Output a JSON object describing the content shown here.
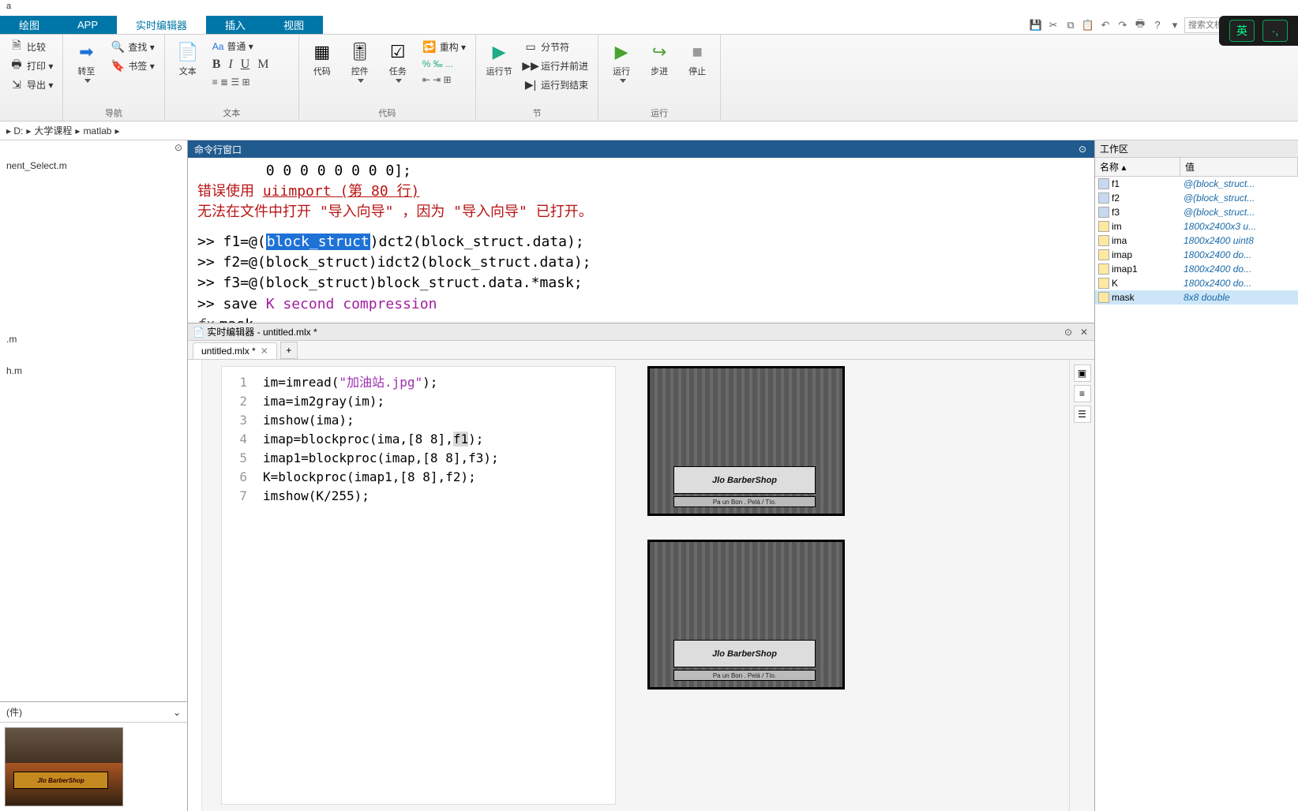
{
  "title": "a",
  "tabs": {
    "t0": "绘图",
    "t1": "APP",
    "t2": "实时编辑器",
    "t3": "插入",
    "t4": "视图"
  },
  "search_placeholder": "搜索文档",
  "ime": {
    "k1": "英",
    "k2": "·,"
  },
  "ribbon": {
    "g0": {
      "items": [
        "比较",
        "打印 ▾",
        "导出 ▾"
      ]
    },
    "g1": {
      "title": "导航",
      "big": "转至",
      "items": [
        "查找 ▾",
        "书签 ▾"
      ]
    },
    "g2": {
      "title": "文本",
      "big": "文本",
      "style_label": "普通 ▾"
    },
    "g3": {
      "title": "代码",
      "items": [
        "代码",
        "控件",
        "任务"
      ],
      "menu": "重构 ▾"
    },
    "g4": {
      "title": "节",
      "big": "运行节",
      "items": [
        "分节符",
        "运行并前进",
        "运行到结束"
      ]
    },
    "g5": {
      "title": "运行",
      "items": [
        "运行",
        "步进",
        "停止"
      ]
    }
  },
  "breadcrumb": {
    "p0": "D:",
    "p1": "大学课程",
    "p2": "matlab"
  },
  "left": {
    "files": [
      "nent_Select.m",
      ".m",
      "h.m"
    ],
    "section_label": "(件)"
  },
  "cmd": {
    "title": "命令行窗口",
    "l0": "        0 0 0 0 0 0 0 0];",
    "err1_a": "错误使用 ",
    "err1_b": "uiimport (第 80 行)",
    "err2": "无法在文件中打开 \"导入向导\" ，因为 \"导入向导\" 已打开。",
    "l1a": ">> f1=@(",
    "l1sel": "block_struct",
    "l1b": ")dct2(block_struct.data);",
    "l2": ">> f2=@(block_struct)idct2(block_struct.data);",
    "l3": ">> f3=@(block_struct)block_struct.data.*mask;",
    "l4a": ">> save ",
    "l4b": "K second compression",
    "fx": "mask"
  },
  "editor": {
    "header": "实时编辑器 - untitled.mlx *",
    "tab": "untitled.mlx *",
    "lines": {
      "1": {
        "a": "im=imread(",
        "s": "\"加油站.jpg\"",
        "b": ");"
      },
      "2": "ima=im2gray(im);",
      "3": "imshow(ima);",
      "4": {
        "a": "imap=blockproc(ima,[8 8],",
        "h": "f1",
        "b": ");"
      },
      "5": "imap1=blockproc(imap,[8 8],f3);",
      "6": "K=blockproc(imap1,[8 8],f2);",
      "7": "imshow(K/255);"
    },
    "sign_text": "Jlo BarberShop",
    "sign_sub": "Pa un Bon . Pelá / Tío."
  },
  "workspace": {
    "title": "工作区",
    "col_name": "名称 ▴",
    "col_val": "值",
    "rows": [
      {
        "n": "f1",
        "v": "@(block_struct...",
        "t": "fn"
      },
      {
        "n": "f2",
        "v": "@(block_struct...",
        "t": "fn"
      },
      {
        "n": "f3",
        "v": "@(block_struct...",
        "t": "fn"
      },
      {
        "n": "im",
        "v": "1800x2400x3 u..."
      },
      {
        "n": "ima",
        "v": "1800x2400 uint8"
      },
      {
        "n": "imap",
        "v": "1800x2400 do..."
      },
      {
        "n": "imap1",
        "v": "1800x2400 do..."
      },
      {
        "n": "K",
        "v": "1800x2400 do..."
      },
      {
        "n": "mask",
        "v": "8x8 double",
        "sel": true
      }
    ]
  }
}
